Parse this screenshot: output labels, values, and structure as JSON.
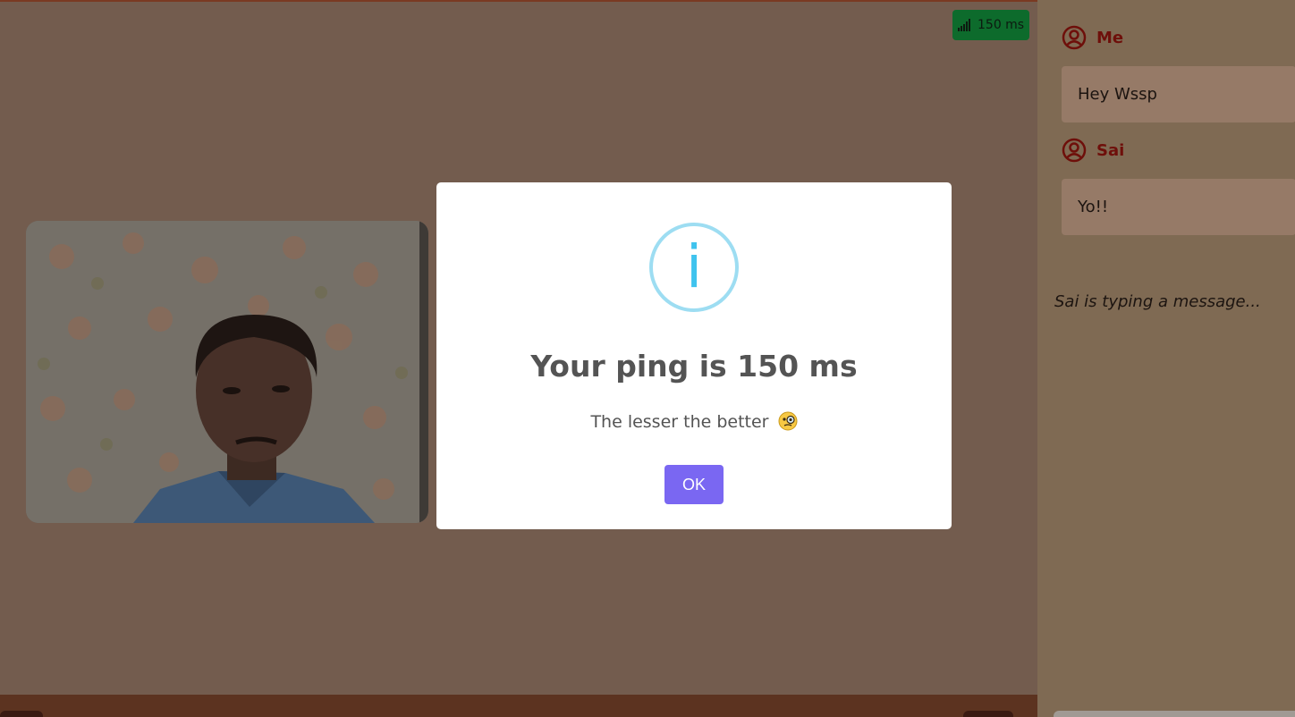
{
  "ping_badge": {
    "label": "150 ms",
    "color": "#0d6b2c"
  },
  "chat": {
    "messages": [
      {
        "sender": "Me",
        "text": "Hey Wssp"
      },
      {
        "sender": "Sai",
        "text": "Yo!!"
      }
    ],
    "typing_indicator": "Sai is typing a message..."
  },
  "modal": {
    "icon": "info-icon",
    "title": "Your ping is 150 ms",
    "text": "The lesser the better",
    "emoji": "monocle-face-emoji",
    "ok_label": "OK"
  },
  "colors": {
    "overlay_main": "#735c4e",
    "sidebar": "#7f6a53",
    "sender_name": "#6e0f0a",
    "ok_button": "#7a67f2",
    "info_icon": "#3fc3ee"
  }
}
